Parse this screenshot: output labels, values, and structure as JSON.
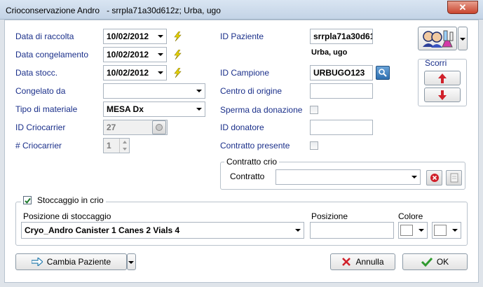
{
  "window": {
    "title": "Crioconservazione Andro",
    "title_detail": "- srrpla71a30d612z; Urba, ugo",
    "close_glyph": "✕"
  },
  "left": {
    "data_raccolta": {
      "label": "Data di raccolta",
      "value": "10/02/2012"
    },
    "data_congelamento": {
      "label": "Data congelamento",
      "value": "10/02/2012"
    },
    "data_stocc": {
      "label": "Data stocc.",
      "value": "10/02/2012"
    },
    "congelato_da": {
      "label": "Congelato da",
      "value": ""
    },
    "tipo_materiale": {
      "label": "Tipo di materiale",
      "value": "MESA Dx"
    },
    "id_criocarrier": {
      "label": "ID Criocarrier",
      "value": "27"
    },
    "num_criocarrier": {
      "label": "# Criocarrier",
      "value": "1"
    }
  },
  "right": {
    "id_paziente": {
      "label": "ID Paziente",
      "value": "srrpla71a30d61",
      "name": "Urba, ugo"
    },
    "id_campione": {
      "label": "ID Campione",
      "value": "URBUGO123"
    },
    "centro_origine": {
      "label": "Centro di origine",
      "value": ""
    },
    "sperma_donazione": {
      "label": "Sperma da donazione"
    },
    "id_donatore": {
      "label": "ID donatore",
      "value": ""
    },
    "contratto_presente": {
      "label": "Contratto presente"
    }
  },
  "scroll": {
    "label": "Scorri"
  },
  "contratto_crio": {
    "group_label": "Contratto crio",
    "label": "Contratto",
    "value": ""
  },
  "stoccaggio": {
    "group_label": "Stoccaggio in crio",
    "posizione_stoccaggio_label": "Posizione di stoccaggio",
    "posizione_stoccaggio_value": "Cryo_Andro Canister 1 Canes 2 Vials 4",
    "posizione_label": "Posizione",
    "posizione_value": "",
    "colore_label": "Colore"
  },
  "footer": {
    "cambia_paziente": "Cambia Paziente",
    "annulla": "Annulla",
    "ok": "OK"
  },
  "colors": {
    "label_blue": "#1a2f8a",
    "lightning_yellow": "#e8d400",
    "arrow_red": "#d0202a",
    "ok_green": "#2f9a2f"
  }
}
